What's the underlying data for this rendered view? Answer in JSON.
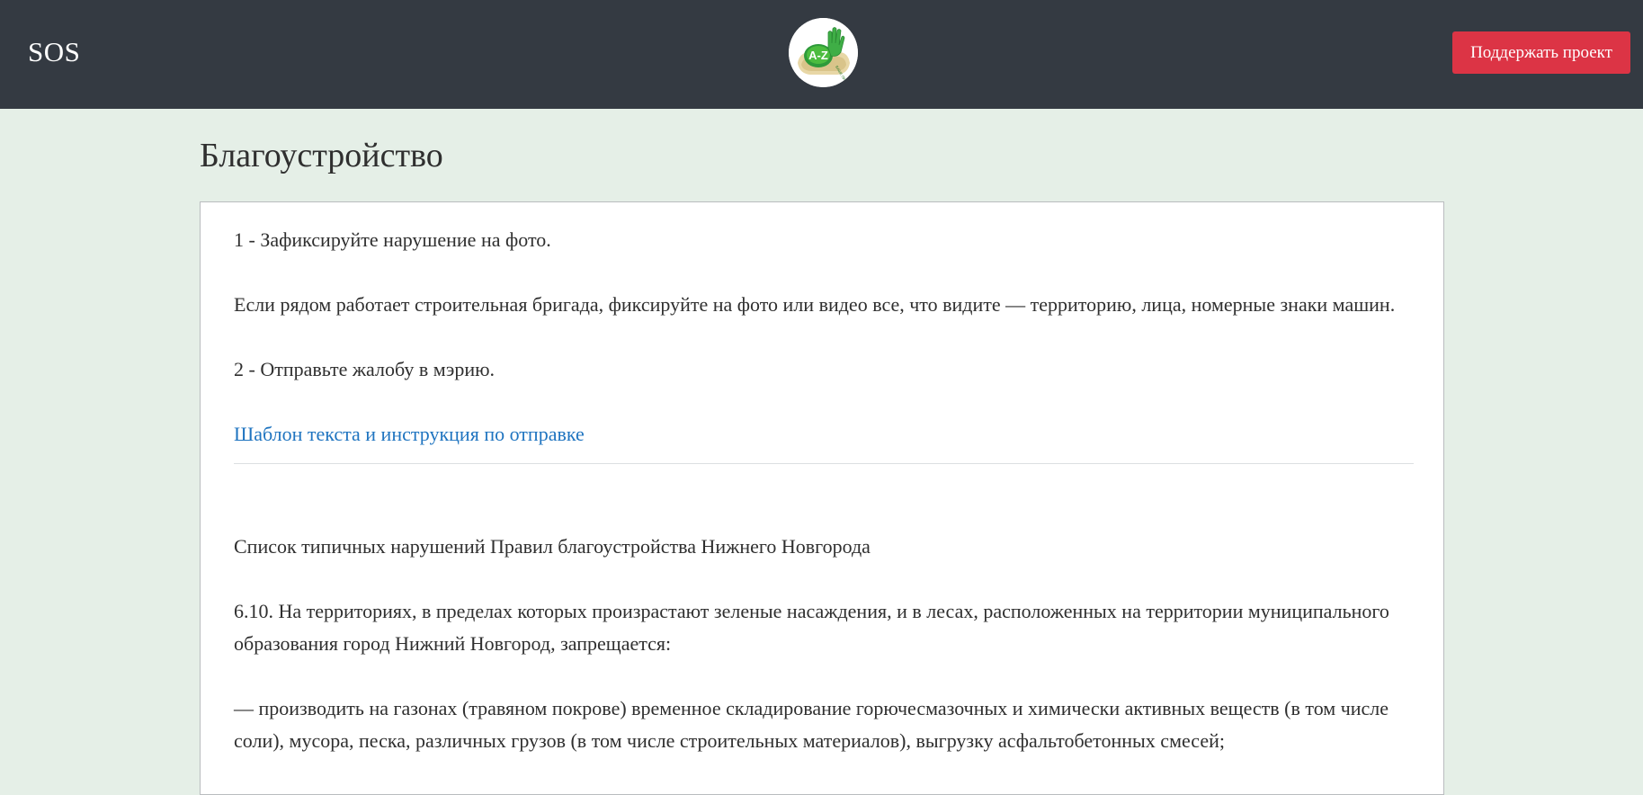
{
  "header": {
    "brand": "SOS",
    "logo_icon": "a-plus-z-hand-logo-icon",
    "support_button": "Поддержать проект",
    "background_color": "#343a42",
    "button_color": "#dc3445"
  },
  "page": {
    "title": "Благоустройство",
    "background_color": "#e5efe7"
  },
  "content": {
    "step1": "1 - Зафиксируйте нарушение на фото.",
    "step1_detail": "Если рядом работает строительная бригада, фиксируйте на фото или видео все, что видите — территорию, лица, номерные знаки машин.",
    "step2": "2 - Отправьте жалобу в мэрию.",
    "template_link": "Шаблон текста и инструкция по отправке",
    "list_title": "Список типичных нарушений Правил благоустройства Нижнего Новгорода",
    "rule_6_10": "6.10. На территориях, в пределах которых произрастают зеленые насаждения, и в лесах, расположенных на территории муниципального образования город Нижний Новгород, запрещается:",
    "rule_item_1": "— производить на газонах (травяном покрове) временное складирование горючесмазочных и химически активных веществ (в том числе соли), мусора, песка, различных грузов (в том числе строительных материалов), выгрузку асфальтобетонных смесей;",
    "link_color": "#1f74c0"
  }
}
